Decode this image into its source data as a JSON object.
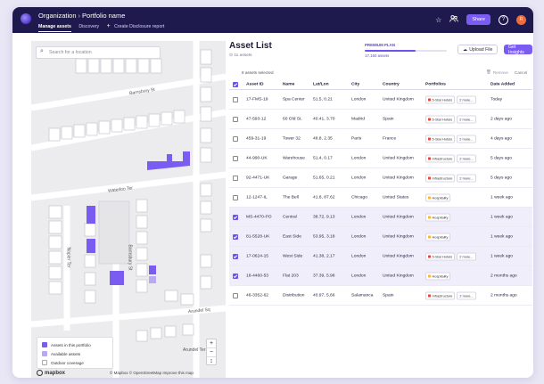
{
  "header": {
    "org": "Organization",
    "portfolio": "Portfolio name",
    "tabs": [
      "Manage assets",
      "Discovery"
    ],
    "create_label": "Create Disclosure report",
    "share_label": "Share",
    "avatar_initial": "R",
    "help_label": "?"
  },
  "map": {
    "search_placeholder": "Search for a location",
    "streets": [
      "Barnsbury St",
      "Waterloo Ter",
      "Napier Ter",
      "Barnsbury St",
      "Arundel Sq",
      "Arundel Ter"
    ],
    "legend": [
      {
        "label": "Assets in this portfolio",
        "color": "#7b5cf2"
      },
      {
        "label": "Available assets",
        "color": "#b7a9f2"
      },
      {
        "label": "Outdoor coverage",
        "color": "#ffffff"
      }
    ],
    "zoom_in": "+",
    "zoom_out": "−",
    "zoom_reset": "↕",
    "mapbox_label": "mapbox",
    "attribution": "© Mapbox © OpenStreetMap Improve this map"
  },
  "panel": {
    "title": "Asset List",
    "count_label": "11 assets",
    "plan_label": "PREMIUM PLAN",
    "plan_used": "17,150 assets",
    "plan_fill_fraction": 0.62,
    "upload_label": "Upload File",
    "insights_label": "Get Insights",
    "selected_label": "8 assets selected",
    "remove_label": "Remove",
    "cancel_label": "Cancel",
    "columns": [
      "Asset ID",
      "Name",
      "Lat/Lon",
      "City",
      "Country",
      "Portfolios",
      "Date Added"
    ],
    "rows": [
      {
        "id": "17-FMS-19",
        "name": "Spa Center",
        "ll": "51.5, 0.21",
        "city": "London",
        "country": "United Kingdom",
        "tags": [
          {
            "label": "5-Star Hotels",
            "color": "#e2483b"
          }
        ],
        "more": "2 more...",
        "date": "Today",
        "selected": false
      },
      {
        "id": "47-593-12",
        "name": "60 Old St.",
        "ll": "40.41, 3.70",
        "city": "Madrid",
        "country": "Spain",
        "tags": [
          {
            "label": "5-Star Hotels",
            "color": "#e2483b"
          }
        ],
        "more": "2 more...",
        "date": "2 days ago",
        "selected": false
      },
      {
        "id": "459-31-19",
        "name": "Tower 32",
        "ll": "48.8, 2.35",
        "city": "Paris",
        "country": "France",
        "tags": [
          {
            "label": "5-Star Hotels",
            "color": "#e2483b"
          }
        ],
        "more": "2 more...",
        "date": "4 days ago",
        "selected": false
      },
      {
        "id": "44-990-UK",
        "name": "Warehouse",
        "ll": "51.4, 0.17",
        "city": "London",
        "country": "United Kingdom",
        "tags": [
          {
            "label": "Infrastructure",
            "color": "#e2483b"
          }
        ],
        "more": "2 more...",
        "date": "5 days ago",
        "selected": false
      },
      {
        "id": "92-4471-UK",
        "name": "Garage",
        "ll": "51.65, 0.21",
        "city": "London",
        "country": "United Kingdom",
        "tags": [
          {
            "label": "Infrastructure",
            "color": "#e2483b"
          }
        ],
        "more": "2 more...",
        "date": "5 days ago",
        "selected": false
      },
      {
        "id": "12-1247-IL",
        "name": "The Bell",
        "ll": "41.8, 87.62",
        "city": "Chicago",
        "country": "United States",
        "tags": [
          {
            "label": "Hospitality",
            "color": "#f5b82e"
          }
        ],
        "more": "",
        "date": "1 week ago",
        "selected": false
      },
      {
        "id": "MS-4470-PO",
        "name": "Central",
        "ll": "38.72, 9.13",
        "city": "London",
        "country": "United Kingdom",
        "tags": [
          {
            "label": "Hospitality",
            "color": "#f5b82e"
          }
        ],
        "more": "",
        "date": "1 week ago",
        "selected": true
      },
      {
        "id": "81-5528-UK",
        "name": "East Side",
        "ll": "53.95, 3.18",
        "city": "London",
        "country": "United Kingdom",
        "tags": [
          {
            "label": "Hospitality",
            "color": "#f5b82e"
          }
        ],
        "more": "",
        "date": "1 week ago",
        "selected": true
      },
      {
        "id": "17-0624-15",
        "name": "West Side",
        "ll": "41.38, 2.17",
        "city": "London",
        "country": "United Kingdom",
        "tags": [
          {
            "label": "5-Star Hotels",
            "color": "#e2483b"
          }
        ],
        "more": "2 more...",
        "date": "1 week ago",
        "selected": true
      },
      {
        "id": "18-4460-53",
        "name": "Flat 203",
        "ll": "37.39, 5.98",
        "city": "London",
        "country": "United Kingdom",
        "tags": [
          {
            "label": "Hospitality",
            "color": "#f5b82e"
          }
        ],
        "more": "",
        "date": "2 months ago",
        "selected": true
      },
      {
        "id": "46-3352-62",
        "name": "Distribution",
        "ll": "40.97, 5.66",
        "city": "Salamanca",
        "country": "Spain",
        "tags": [
          {
            "label": "Infrastructure",
            "color": "#e2483b"
          }
        ],
        "more": "2 more...",
        "date": "2 months ago",
        "selected": false
      }
    ]
  }
}
